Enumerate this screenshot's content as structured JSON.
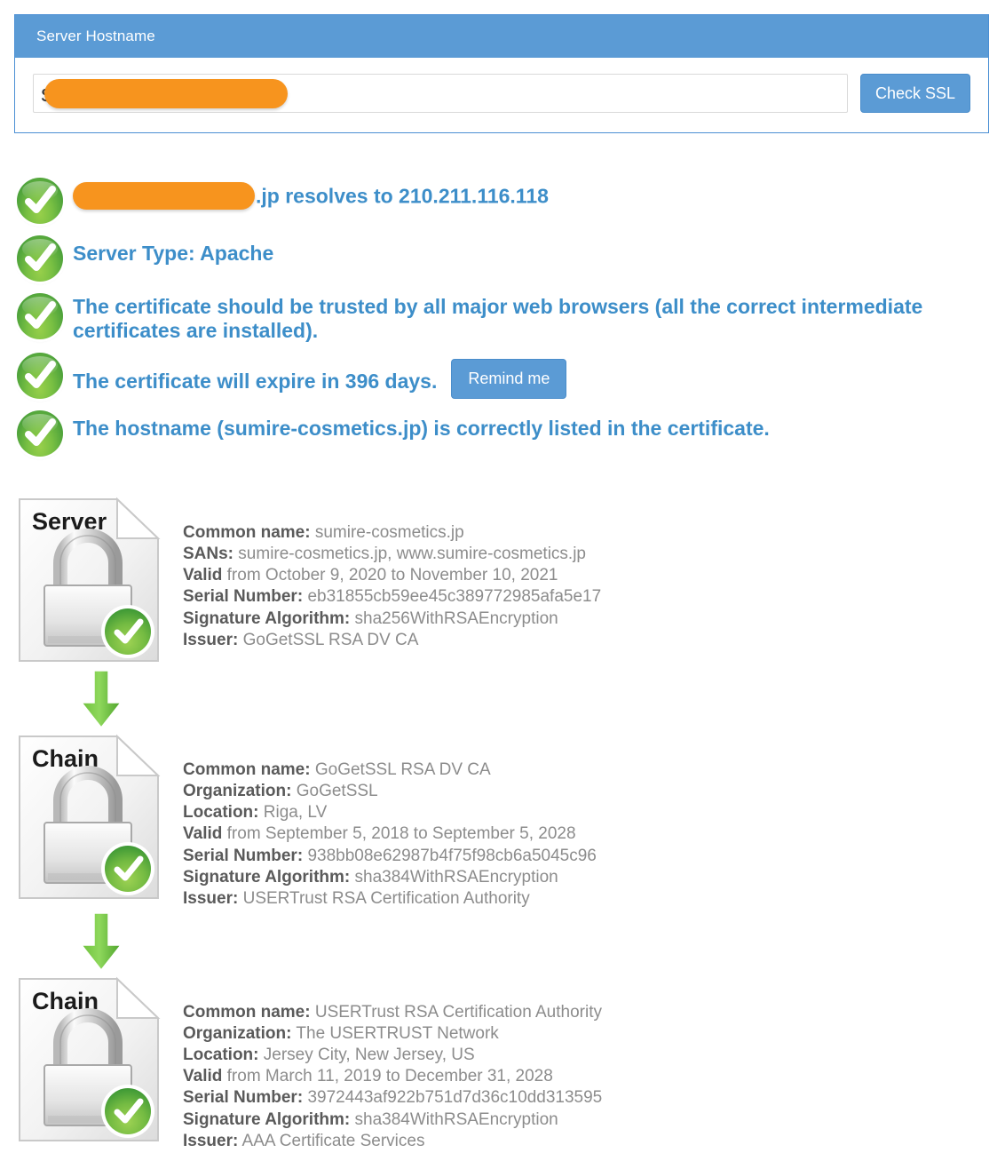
{
  "panel": {
    "title": "Server Hostname",
    "hostname_value": "s.jp",
    "hostname_placeholder": "Server Hostname",
    "check_button": "Check SSL"
  },
  "status": {
    "resolves_suffix": ".jp resolves to 210.211.116.118",
    "server_type": "Server Type: Apache",
    "trusted": "The certificate should be trusted by all major web browsers (all the correct intermediate certificates are installed).",
    "expiry": "The certificate will expire in 396 days.",
    "remind_button": "Remind me",
    "hostname_listed": "The hostname (sumire-cosmetics.jp) is correctly listed in the certificate."
  },
  "certificates": [
    {
      "icon_label": "Server",
      "fields": [
        {
          "key": "Common name:",
          "value": "sumire-cosmetics.jp"
        },
        {
          "key": "SANs:",
          "value": "sumire-cosmetics.jp, www.sumire-cosmetics.jp"
        },
        {
          "key": "Valid",
          "value": "from October 9, 2020 to November 10, 2021"
        },
        {
          "key": "Serial Number:",
          "value": "eb31855cb59ee45c389772985afa5e17"
        },
        {
          "key": "Signature Algorithm:",
          "value": "sha256WithRSAEncryption"
        },
        {
          "key": "Issuer:",
          "value": "GoGetSSL RSA DV CA"
        }
      ]
    },
    {
      "icon_label": "Chain",
      "fields": [
        {
          "key": "Common name:",
          "value": "GoGetSSL RSA DV CA"
        },
        {
          "key": "Organization:",
          "value": "GoGetSSL"
        },
        {
          "key": "Location:",
          "value": "Riga, LV"
        },
        {
          "key": "Valid",
          "value": "from September 5, 2018 to September 5, 2028"
        },
        {
          "key": "Serial Number:",
          "value": "938bb08e62987b4f75f98cb6a5045c96"
        },
        {
          "key": "Signature Algorithm:",
          "value": "sha384WithRSAEncryption"
        },
        {
          "key": "Issuer:",
          "value": "USERTrust RSA Certification Authority"
        }
      ]
    },
    {
      "icon_label": "Chain",
      "fields": [
        {
          "key": "Common name:",
          "value": "USERTrust RSA Certification Authority"
        },
        {
          "key": "Organization:",
          "value": "The USERTRUST Network"
        },
        {
          "key": "Location:",
          "value": "Jersey City, New Jersey, US"
        },
        {
          "key": "Valid",
          "value": "from March 11, 2019 to December 31, 2028"
        },
        {
          "key": "Serial Number:",
          "value": "3972443af922b751d7d36c10dd313595"
        },
        {
          "key": "Signature Algorithm:",
          "value": "sha384WithRSAEncryption"
        },
        {
          "key": "Issuer:",
          "value": "AAA Certificate Services"
        }
      ]
    }
  ],
  "colors": {
    "accent_blue": "#5b9bd5",
    "status_text_blue": "#3d8ec9",
    "redaction_orange": "#f7941e",
    "check_green": "#79c043"
  }
}
